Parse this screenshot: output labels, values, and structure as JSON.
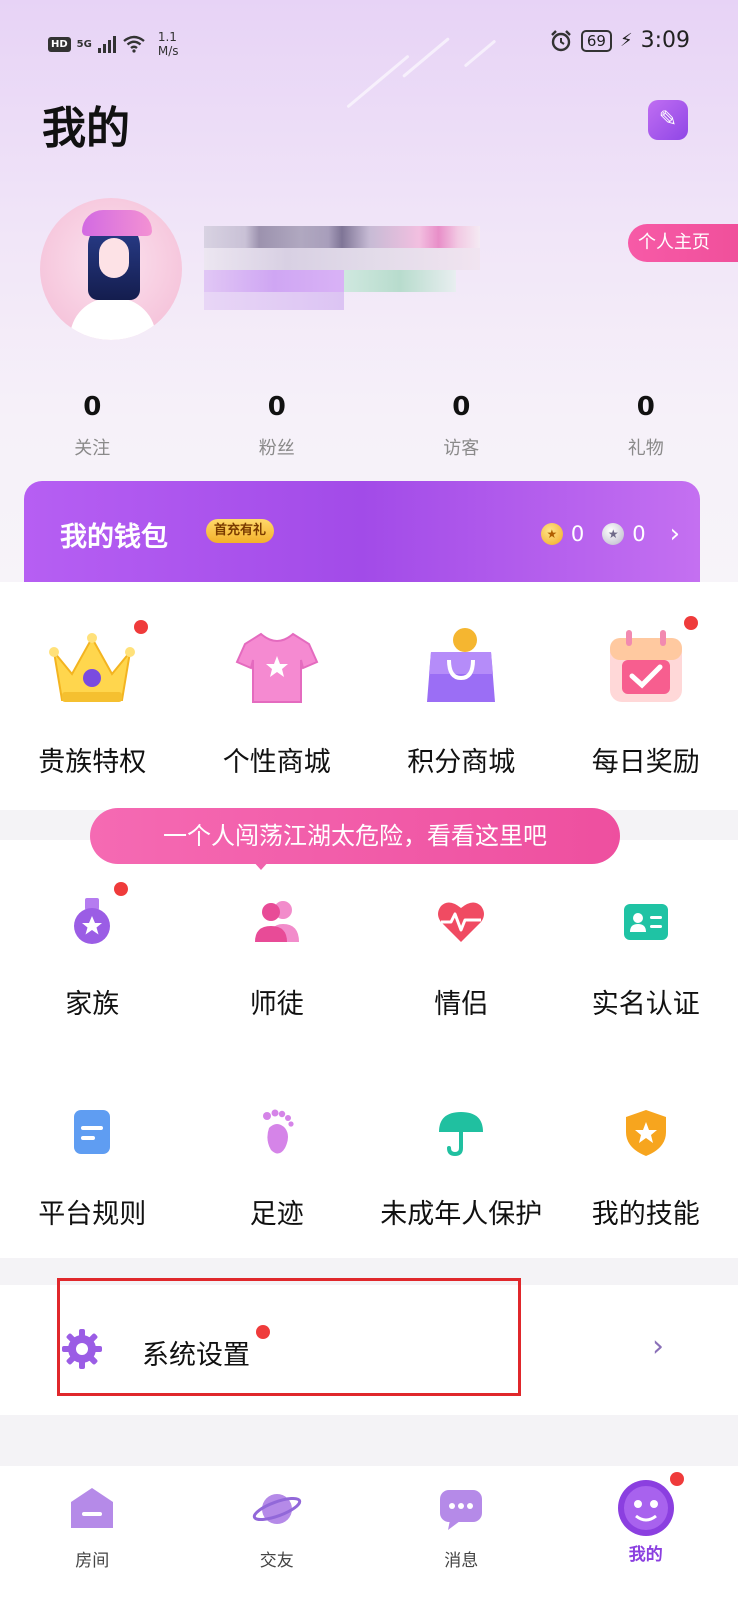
{
  "status_bar": {
    "hd": "HD",
    "network": "5G",
    "speed_top": "1.1",
    "speed_bottom": "M/s",
    "battery": "69",
    "time": "3:09"
  },
  "header": {
    "title": "我的",
    "profile_link": "个人主页"
  },
  "stats": [
    {
      "value": "0",
      "label": "关注"
    },
    {
      "value": "0",
      "label": "粉丝"
    },
    {
      "value": "0",
      "label": "访客"
    },
    {
      "value": "0",
      "label": "礼物"
    }
  ],
  "wallet": {
    "title": "我的钱包",
    "badge": "首充有礼",
    "gold_coins": "0",
    "silver_coins": "0"
  },
  "features": [
    {
      "label": "贵族特权",
      "icon": "crown-icon",
      "has_dot": true
    },
    {
      "label": "个性商城",
      "icon": "tshirt-icon",
      "has_dot": false
    },
    {
      "label": "积分商城",
      "icon": "shopping-bag-icon",
      "has_dot": false
    },
    {
      "label": "每日奖励",
      "icon": "calendar-check-icon",
      "has_dot": true
    }
  ],
  "tooltip": "一个人闯荡江湖太危险，看看这里吧",
  "social": [
    {
      "label": "家族",
      "icon": "medal-icon",
      "has_dot": true
    },
    {
      "label": "师徒",
      "icon": "people-icon",
      "has_dot": false
    },
    {
      "label": "情侣",
      "icon": "heartbeat-icon",
      "has_dot": false
    },
    {
      "label": "实名认证",
      "icon": "id-card-icon",
      "has_dot": false
    }
  ],
  "services": [
    {
      "label": "平台规则",
      "icon": "document-icon"
    },
    {
      "label": "足迹",
      "icon": "footprint-icon"
    },
    {
      "label": "未成年人保护",
      "icon": "umbrella-icon"
    },
    {
      "label": "我的技能",
      "icon": "shield-star-icon"
    }
  ],
  "settings": {
    "label": "系统设置",
    "icon": "gear-icon"
  },
  "tabs": [
    {
      "label": "房间",
      "icon": "room-icon"
    },
    {
      "label": "交友",
      "icon": "planet-icon"
    },
    {
      "label": "消息",
      "icon": "message-icon"
    },
    {
      "label": "我的",
      "icon": "profile-icon",
      "active": true
    }
  ],
  "colors": {
    "accent": "#a24be8",
    "pink": "#f0509b",
    "badge_red": "#ef3b3b"
  }
}
